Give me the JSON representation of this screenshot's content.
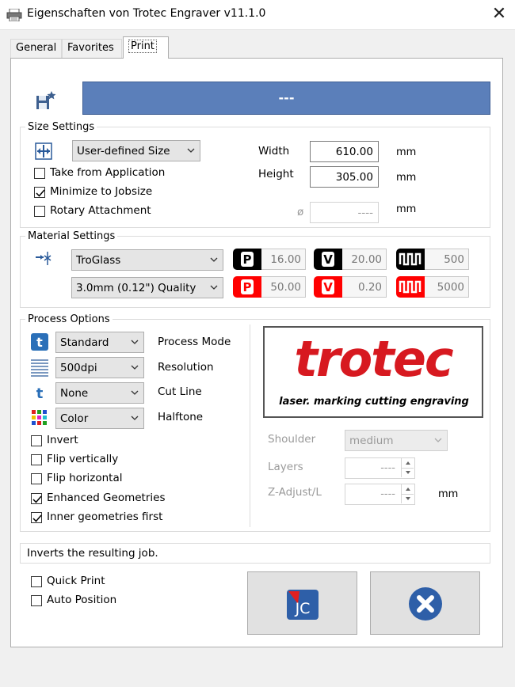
{
  "window": {
    "title": "Eigenschaften von Trotec Engraver v11.1.0"
  },
  "tabs": [
    {
      "label": "General",
      "active": false
    },
    {
      "label": "Favorites",
      "active": false
    },
    {
      "label": "Print",
      "active": true
    }
  ],
  "job_name": "---",
  "size_settings": {
    "legend": "Size Settings",
    "size_select": "User-defined Size",
    "take_from_application": {
      "label": "Take from Application",
      "checked": false
    },
    "minimize_to_jobsize": {
      "label": "Minimize to Jobsize",
      "checked": true
    },
    "rotary_attachment": {
      "label": "Rotary Attachment",
      "checked": false
    },
    "width": {
      "label": "Width",
      "value": "610.00",
      "unit": "mm"
    },
    "height": {
      "label": "Height",
      "value": "305.00",
      "unit": "mm"
    },
    "diameter": {
      "symbol": "ø",
      "value": "----",
      "unit": "mm"
    }
  },
  "material_settings": {
    "legend": "Material Settings",
    "material_select": "TroGlass",
    "quality_select": "3.0mm (0.12\") Quality",
    "engrave": {
      "power": "16.00",
      "velocity": "20.00",
      "frequency": "500",
      "color": "#000000"
    },
    "cut": {
      "power": "50.00",
      "velocity": "0.20",
      "frequency": "5000",
      "color": "#ff0000"
    }
  },
  "process_options": {
    "legend": "Process Options",
    "process_mode": {
      "value": "Standard",
      "label": "Process Mode"
    },
    "resolution": {
      "value": "500dpi",
      "label": "Resolution"
    },
    "cut_line": {
      "value": "None",
      "label": "Cut Line"
    },
    "halftone": {
      "value": "Color",
      "label": "Halftone"
    },
    "invert": {
      "label": "Invert",
      "checked": false
    },
    "flip_vertically": {
      "label": "Flip vertically",
      "checked": false
    },
    "flip_horizontal": {
      "label": "Flip horizontal",
      "checked": false
    },
    "enhanced_geometries": {
      "label": "Enhanced Geometries",
      "checked": true
    },
    "inner_geometries_first": {
      "label": "Inner geometries first",
      "checked": true
    },
    "logo": {
      "word": "trotec",
      "tagline": "laser. marking cutting engraving",
      "color": "#d71920"
    },
    "shoulder": {
      "label": "Shoulder",
      "value": "medium"
    },
    "layers": {
      "label": "Layers",
      "value": "----"
    },
    "z_adjust": {
      "label": "Z-Adjust/L",
      "value": "----",
      "unit": "mm"
    }
  },
  "status_text": "Inverts the resulting job.",
  "quick_print": {
    "label": "Quick Print",
    "checked": false
  },
  "auto_position": {
    "label": "Auto Position",
    "checked": false
  },
  "colors": {
    "job_bar": "#5b7fba",
    "accent_blue": "#2a6fb8",
    "close_blue": "#2e5fa8"
  },
  "icons": [
    "printer-icon",
    "close-icon",
    "save-favorite-icon",
    "size-icon",
    "material-icon",
    "process-mode-icon",
    "resolution-icon",
    "cut-line-icon",
    "halftone-icon",
    "jobcontrol-icon",
    "cancel-icon"
  ]
}
